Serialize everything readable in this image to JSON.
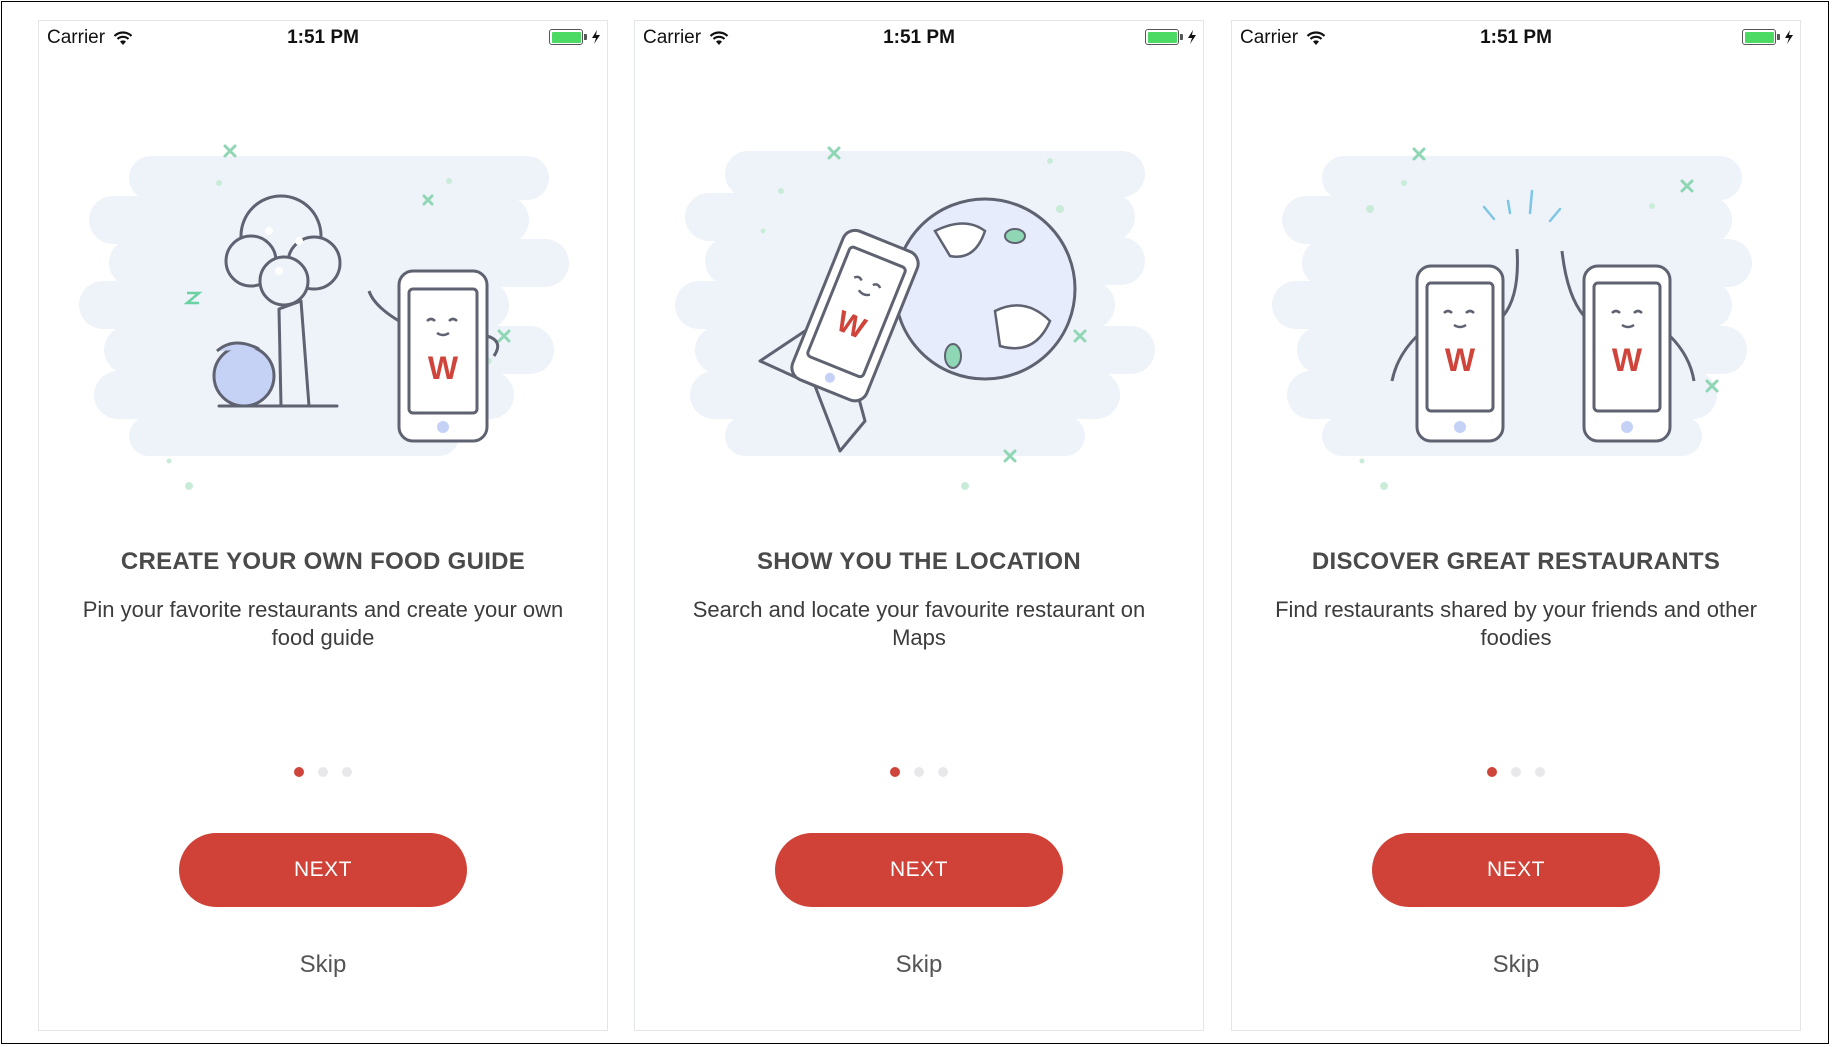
{
  "status_bar": {
    "carrier": "Carrier",
    "time": "1:51 PM"
  },
  "screens": [
    {
      "title": "CREATE YOUR OWN FOOD GUIDE",
      "subtitle": "Pin your favorite restaurants and create your own food guide",
      "next_label": "NEXT",
      "skip_label": "Skip",
      "active_page": 1,
      "page_count": 3,
      "illustration_icon": "sleeping-phone-under-tree-icon"
    },
    {
      "title": "SHOW YOU THE LOCATION",
      "subtitle": "Search and locate your favourite restaurant on Maps",
      "next_label": "NEXT",
      "skip_label": "Skip",
      "active_page": 1,
      "page_count": 3,
      "illustration_icon": "flying-phone-globe-icon"
    },
    {
      "title": "DISCOVER GREAT RESTAURANTS",
      "subtitle": "Find restaurants shared by your friends and other foodies",
      "next_label": "NEXT",
      "skip_label": "Skip",
      "active_page": 1,
      "page_count": 3,
      "illustration_icon": "high-five-phones-icon"
    }
  ],
  "logo_text": "W",
  "colors": {
    "accent": "#d04237",
    "title": "#4a4a4a",
    "dot_inactive": "#e8e8ea",
    "battery": "#4cd964",
    "illustration_bg": "#eef2f9",
    "sparkle": "#8fd6b4"
  }
}
